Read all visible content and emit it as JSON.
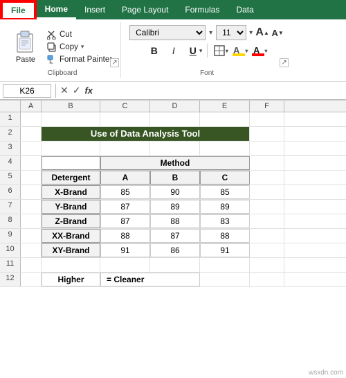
{
  "tabs": [
    {
      "id": "file",
      "label": "File",
      "active": true,
      "isFile": true
    },
    {
      "id": "home",
      "label": "Home",
      "active": false
    },
    {
      "id": "insert",
      "label": "Insert"
    },
    {
      "id": "page-layout",
      "label": "Page Layout"
    },
    {
      "id": "formulas",
      "label": "Formulas"
    },
    {
      "id": "data",
      "label": "Data"
    }
  ],
  "clipboard": {
    "paste_label": "Paste",
    "cut_label": "Cut",
    "copy_label": "Copy",
    "format_painter_label": "Format Painter",
    "group_label": "Clipboard"
  },
  "font": {
    "name": "Calibri",
    "size": "11",
    "bold": "B",
    "italic": "I",
    "underline": "U",
    "group_label": "Font",
    "size_increase": "A",
    "size_decrease": "A"
  },
  "formula_bar": {
    "cell_ref": "K26",
    "fx": "fx",
    "cancel": "✕",
    "confirm": "✓"
  },
  "columns": [
    "A",
    "B",
    "C",
    "D",
    "E",
    "F"
  ],
  "rows": [
    1,
    2,
    3,
    4,
    5,
    6,
    7,
    8,
    9,
    10,
    11,
    12
  ],
  "spreadsheet": {
    "title": "Use of Data Analysis Tool",
    "method_header": "Method",
    "detergent_header": "Detergent",
    "col_a_header": "A",
    "col_b_header": "B",
    "col_c_header": "C",
    "brands": [
      {
        "name": "X-Brand",
        "a": 85,
        "b": 90,
        "c": 85
      },
      {
        "name": "Y-Brand",
        "a": 87,
        "b": 89,
        "c": 89
      },
      {
        "name": "Z-Brand",
        "a": 87,
        "b": 88,
        "c": 83
      },
      {
        "name": "XX-Brand",
        "a": 88,
        "b": 87,
        "c": 88
      },
      {
        "name": "XY-Brand",
        "a": 91,
        "b": 86,
        "c": 91
      }
    ],
    "higher_label": "Higher",
    "cleaner_label": "= Cleaner"
  },
  "watermark": "wsxdn.com"
}
